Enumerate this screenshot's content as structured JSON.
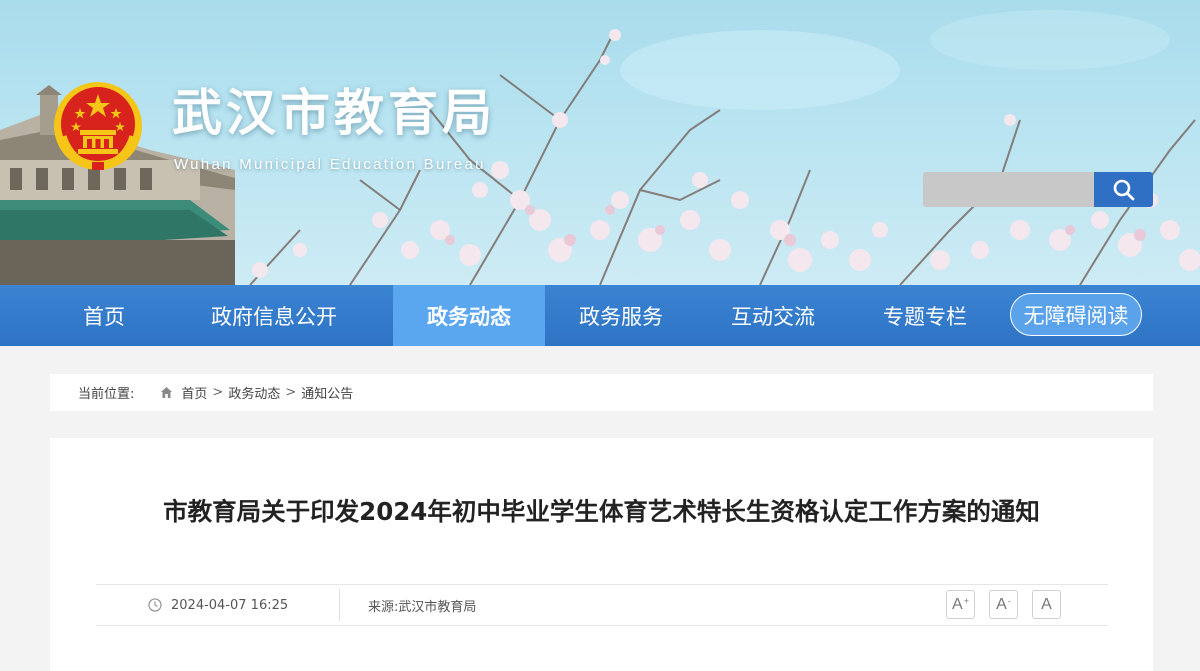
{
  "header": {
    "title": "武汉市教育局",
    "subtitle": "Wuhan Municipal Education Bureau",
    "search": {
      "placeholder": "",
      "icon": "search-icon"
    }
  },
  "nav": {
    "items": [
      {
        "label": "首页",
        "active": false
      },
      {
        "label": "政府信息公开",
        "active": false
      },
      {
        "label": "政务动态",
        "active": true
      },
      {
        "label": "政务服务",
        "active": false
      },
      {
        "label": "互动交流",
        "active": false
      },
      {
        "label": "专题专栏",
        "active": false
      }
    ],
    "accessibility_label": "无障碍阅读"
  },
  "breadcrumb": {
    "label": "当前位置:",
    "items": [
      "首页",
      "政务动态",
      "通知公告"
    ],
    "separator": ">"
  },
  "article": {
    "title": "市教育局关于印发2024年初中毕业学生体育艺术特长生资格认定工作方案的通知",
    "date": "2024-04-07 16:25",
    "source": "来源:武汉市教育局",
    "font_controls": [
      "A",
      "A",
      "A"
    ],
    "font_controls_marks": [
      "+",
      "-",
      ""
    ]
  },
  "colors": {
    "nav_bg": "#2f73c4",
    "nav_active": "#5aa6ef",
    "search_button": "#2f6fc4",
    "emblem_red": "#d8231c",
    "emblem_gold": "#f5c518"
  }
}
